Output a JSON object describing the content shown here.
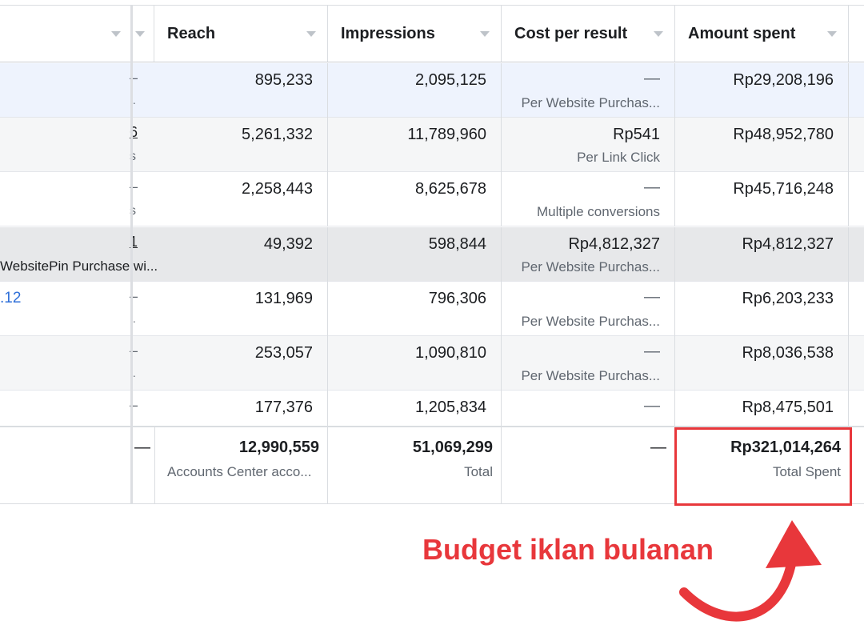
{
  "columns": {
    "reach": "Reach",
    "impressions": "Impressions",
    "cost_per_result": "Cost per result",
    "amount_spent": "Amount spent"
  },
  "rows": [
    {
      "frag": "–",
      "frag2": "..",
      "reach": "895,233",
      "impressions": "2,095,125",
      "cost": "—",
      "cost_sub": "Per Website Purchas...",
      "spent": "Rp29,208,196"
    },
    {
      "frag": "6",
      "frag2": "s",
      "reach": "5,261,332",
      "impressions": "11,789,960",
      "cost": "Rp541",
      "cost_sub": "Per Link Click",
      "spent": "Rp48,952,780"
    },
    {
      "frag": "–",
      "frag2": "s",
      "reach": "2,258,443",
      "impressions": "8,625,678",
      "cost": "—",
      "cost_sub": "Multiple conversions",
      "spent": "Rp45,716,248"
    },
    {
      "frag": "1",
      "frag2": "",
      "reach": "49,392",
      "impressions": "598,844",
      "cost": "Rp4,812,327",
      "cost_sub": "Per Website Purchas...",
      "spent": "Rp4,812,327"
    },
    {
      "frag": "–",
      "frag2": "..",
      "reach": "131,969",
      "impressions": "796,306",
      "cost": "—",
      "cost_sub": "Per Website Purchas...",
      "spent": "Rp6,203,233"
    },
    {
      "frag": "–",
      "frag2": "..",
      "reach": "253,057",
      "impressions": "1,090,810",
      "cost": "—",
      "cost_sub": "Per Website Purchas...",
      "spent": "Rp8,036,538"
    },
    {
      "frag": "–",
      "frag2": "",
      "reach": "177,376",
      "impressions": "1,205,834",
      "cost": "—",
      "cost_sub": "",
      "spent": "Rp8,475,501"
    }
  ],
  "left_fragments": {
    "pin_label": "WebsitePin Purchase wi...",
    "link_text": ".12"
  },
  "totals": {
    "dash_left": "—",
    "reach": "12,990,559",
    "reach_sub": "Accounts Center acco...",
    "impressions": "51,069,299",
    "impressions_sub": "Total",
    "cost": "—",
    "spent": "Rp321,014,264",
    "spent_sub": "Total Spent"
  },
  "annotation": {
    "text": "Budget iklan bulanan",
    "color": "#e8373b"
  }
}
